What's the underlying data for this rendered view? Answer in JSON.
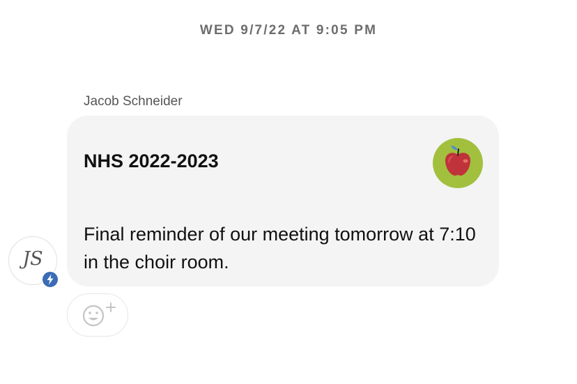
{
  "timestamp": "WED 9/7/22 AT 9:05 PM",
  "message": {
    "sender": "Jacob Schneider",
    "group_name": "NHS 2022-2023",
    "group_icon": "apple-icon",
    "body": "Final reminder of our meeting tomorrow at 7:10 in the choir room.",
    "avatar_initials": "JS",
    "badge_icon": "lightning-icon"
  },
  "reaction_button_icon": "add-emoji-icon",
  "colors": {
    "bubble_background": "#f4f4f4",
    "group_icon_background": "#a2c03e",
    "badge_background": "#3b6cb5",
    "timestamp_text": "#6d6d6d"
  }
}
